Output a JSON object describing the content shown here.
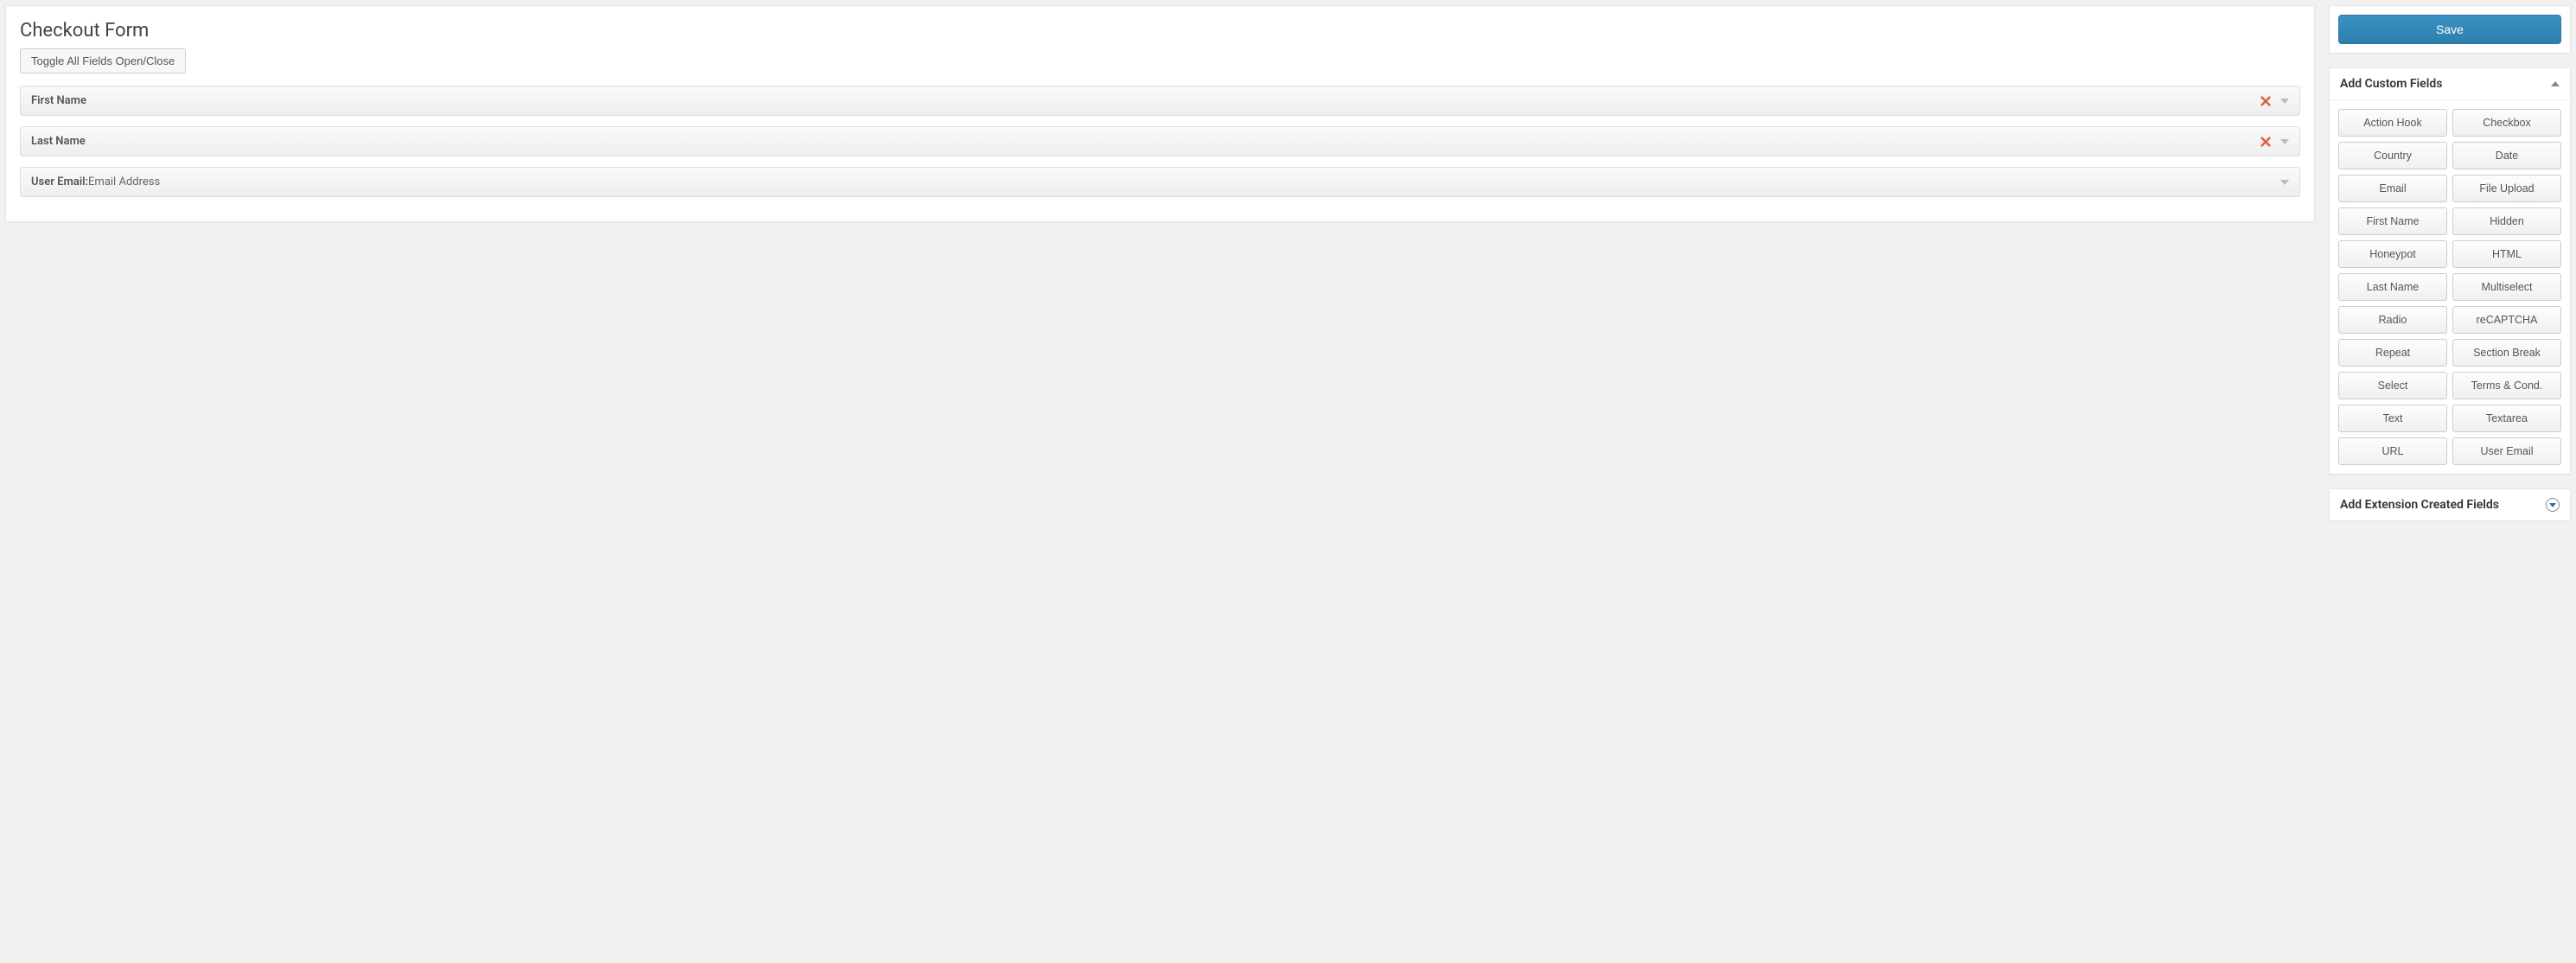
{
  "main": {
    "title": "Checkout Form",
    "toggleLabel": "Toggle All Fields Open/Close",
    "fields": [
      {
        "label": "First Name",
        "sub": "",
        "removable": true
      },
      {
        "label": "Last Name",
        "sub": "",
        "removable": true
      },
      {
        "label": "User Email:",
        "sub": " Email Address",
        "removable": false
      }
    ]
  },
  "save": {
    "label": "Save"
  },
  "customFields": {
    "title": "Add Custom Fields",
    "items": [
      "Action Hook",
      "Checkbox",
      "Country",
      "Date",
      "Email",
      "File Upload",
      "First Name",
      "Hidden",
      "Honeypot",
      "HTML",
      "Last Name",
      "Multiselect",
      "Radio",
      "reCAPTCHA",
      "Repeat",
      "Section Break",
      "Select",
      "Terms & Cond.",
      "Text",
      "Textarea",
      "URL",
      "User Email"
    ]
  },
  "extensionFields": {
    "title": "Add Extension Created Fields"
  }
}
